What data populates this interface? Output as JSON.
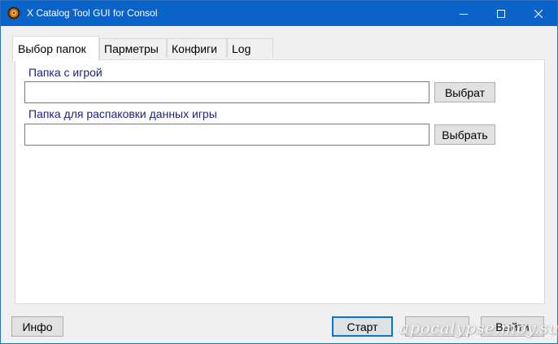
{
  "window": {
    "title": "X Catalog Tool GUI for Consol",
    "colors": {
      "titlebar": "#0a63c9",
      "label_text": "#1a237e",
      "default_button_border": "#0078d7"
    },
    "icons": {
      "app": "app-logo-icon",
      "minimize": "minimize-icon",
      "maximize": "maximize-icon",
      "close": "close-icon"
    }
  },
  "tabs": [
    {
      "label": "Выбор папок",
      "active": true
    },
    {
      "label": "Парметры",
      "active": false
    },
    {
      "label": "Конфиги",
      "active": false
    },
    {
      "label": "Log",
      "active": false
    }
  ],
  "folders": {
    "game_folder": {
      "label": "Папка с игрой",
      "value": "",
      "button": "Выбрат"
    },
    "unpack_folder": {
      "label": "Папка для распаковки данных игры",
      "value": "",
      "button": "Выбрать"
    }
  },
  "footer": {
    "info_button": "Инфо",
    "start_button": "Старт",
    "exit_button": "Выйти"
  },
  "watermark": "apocalypse.moy.su"
}
